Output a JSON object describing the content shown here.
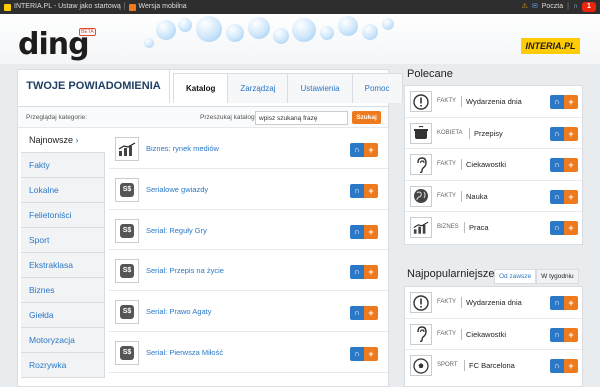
{
  "topbar": {
    "left_text": "INTERIA.PL - Ustaw jako startową",
    "mobile_text": "Wersja mobilna",
    "mail_label": "Poczta",
    "notification_count": "1"
  },
  "header": {
    "logo": "ding",
    "beta": "BETA",
    "partner": "INTERIA.PL"
  },
  "main": {
    "title": "TWOJE POWIADOMIENIA",
    "tabs": [
      "Katalog",
      "Zarządzaj",
      "Ustawienia",
      "Pomoc"
    ],
    "filter": {
      "browse_label": "Przeglądaj kategorie:",
      "search_label": "Przeszukaj katalog:",
      "search_placeholder": "wpisz szukaną frazę",
      "search_button": "Szukaj"
    },
    "categories": [
      "Najnowsze",
      "Fakty",
      "Lokalne",
      "Felietoniści",
      "Sport",
      "Ekstraklasa",
      "Biznes",
      "Giełda",
      "Motoryzacja",
      "Rozrywka"
    ],
    "feeds": [
      {
        "name": "Biznes: rynek mediów",
        "icon": "chart-icon"
      },
      {
        "name": "Serialowe gwiazdy",
        "icon": "ss-icon"
      },
      {
        "name": "Serial: Reguły Gry",
        "icon": "ss-icon"
      },
      {
        "name": "Serial: Przepis na życie",
        "icon": "ss-icon"
      },
      {
        "name": "Serial: Prawo Agaty",
        "icon": "ss-icon"
      },
      {
        "name": "Serial: Pierwsza Miłość",
        "icon": "ss-icon"
      }
    ]
  },
  "polecane": {
    "title": "Polecane",
    "items": [
      {
        "tag": "FAKTY",
        "name": "Wydarzenia dnia",
        "icon": "exclamation-icon"
      },
      {
        "tag": "KOBIETA",
        "name": "Przepisy",
        "icon": "pot-icon"
      },
      {
        "tag": "FAKTY",
        "name": "Ciekawostki",
        "icon": "ear-icon"
      },
      {
        "tag": "FAKTY",
        "name": "Nauka",
        "icon": "globe-icon"
      },
      {
        "tag": "BIZNES",
        "name": "Praca",
        "icon": "chart-icon"
      }
    ]
  },
  "popular": {
    "title": "Najpopularniejsze",
    "tabs": [
      "Od zawsze",
      "W tygodniu"
    ],
    "items": [
      {
        "tag": "FAKTY",
        "name": "Wydarzenia dnia",
        "icon": "exclamation-icon"
      },
      {
        "tag": "FAKTY",
        "name": "Ciekawostki",
        "icon": "ear-icon"
      },
      {
        "tag": "SPORT",
        "name": "FC Barcelona",
        "icon": "ball-icon"
      }
    ]
  },
  "add_button": {
    "left": "∩",
    "right": "+"
  }
}
